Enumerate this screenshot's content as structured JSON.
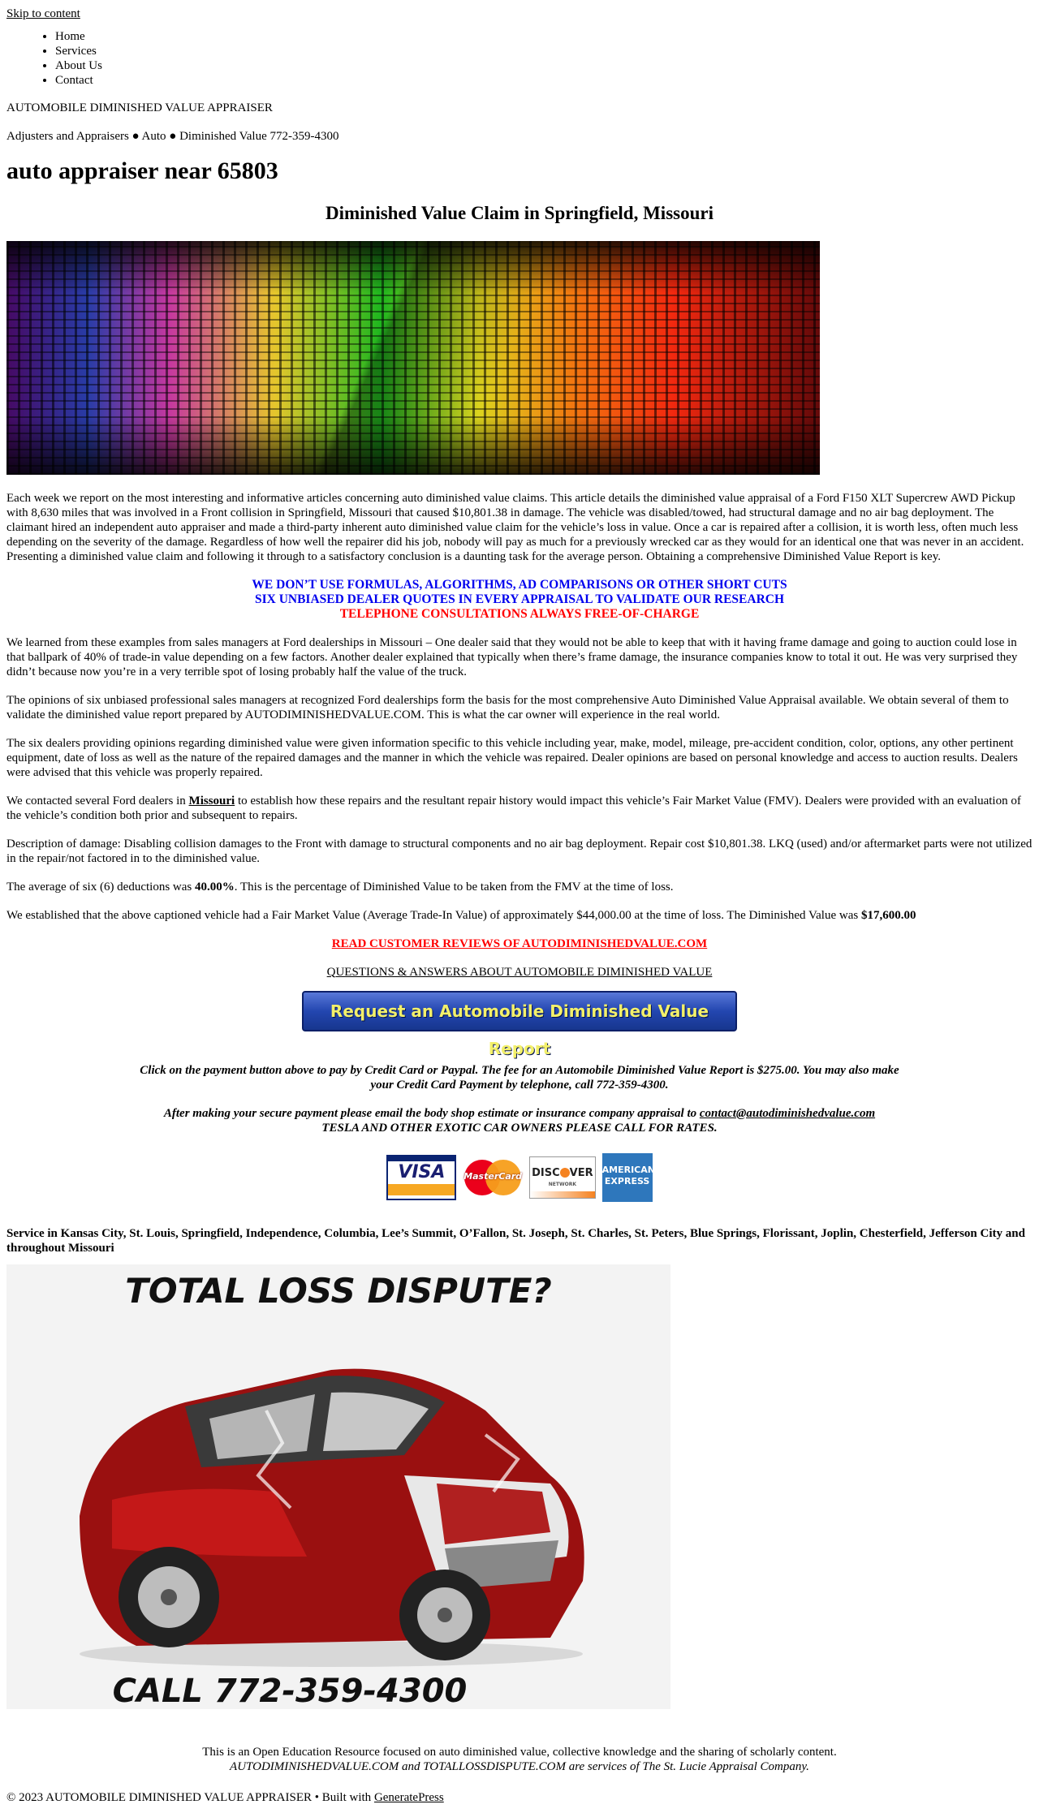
{
  "skip_link": "Skip to content",
  "nav": {
    "items": [
      "Home",
      "Services",
      "About Us",
      "Contact"
    ]
  },
  "site": {
    "title": "AUTOMOBILE DIMINISHED VALUE APPRAISER",
    "description": "Adjusters and Appraisers ● Auto ● Diminished Value 772-359-4300"
  },
  "page": {
    "title": "auto appraiser near 65803",
    "subtitle": "Diminished Value Claim in Springfield, Missouri"
  },
  "article": {
    "intro": "Each week we report on the most interesting and informative articles concerning auto diminished value claims. This article details the diminished value appraisal of a Ford F150 XLT Supercrew AWD Pickup with 8,630 miles that was involved in a Front collision in Springfield, Missouri that caused $10,801.38 in damage. The vehicle was disabled/towed, had structural damage and no air bag deployment. The claimant hired an independent auto appraiser and made a third-party inherent auto diminished value claim for the vehicle’s loss in value. Once a car is repaired after a collision, it is worth less, often much less depending on the severity of the damage. Regardless of how well the repairer did his job, nobody will pay as much for a previously wrecked car as they would for an identical one that was never in an accident. Presenting a diminished value claim and following it through to a satisfactory conclusion is a daunting task for the average person. Obtaining a comprehensive Diminished Value Report is key.",
    "callout_1": "WE DON’T USE FORMULAS, ALGORITHMS, AD COMPARISONS OR OTHER SHORT CUTS",
    "callout_2": "SIX UNBIASED DEALER QUOTES IN EVERY APPRAISAL TO VALIDATE OUR RESEARCH",
    "callout_3": "TELEPHONE CONSULTATIONS ALWAYS FREE-OF-CHARGE",
    "p1": "We learned from these examples from sales managers at Ford dealerships in Missouri – One dealer said that they would not be able to keep that with it having frame damage and going to auction could lose in that ballpark of 40% of trade-in value depending on a few factors. Another dealer explained that typically when there’s frame damage, the insurance companies know to total it out. He was very surprised they didn’t because now you’re in a very terrible spot of losing probably half the value of the truck.",
    "p2": "The opinions of six unbiased professional sales managers at recognized Ford dealerships form the basis for the most comprehensive Auto Diminished Value Appraisal available. We obtain several of them to validate the diminished value report prepared by AUTODIMINISHEDVALUE.COM. This is what the car owner will experience in the real world.",
    "p3": "The six dealers providing opinions regarding diminished value were given information specific to this vehicle including year, make, model, mileage, pre-accident condition, color, options, any other pertinent equipment, date of loss as well as the nature of the repaired damages and the manner in which the vehicle was repaired. Dealer opinions are based on personal knowledge and access to auction results. Dealers were advised that this vehicle was properly repaired.",
    "p4_before": "We contacted several Ford dealers in ",
    "p4_link": "Missouri",
    "p4_after": " to establish how these repairs and the resultant repair history would impact this vehicle’s Fair Market Value (FMV). Dealers were provided with an evaluation of the vehicle’s condition both prior and subsequent to repairs.",
    "p5": "Description of damage: Disabling collision damages to the Front with damage to structural components and no air bag deployment. Repair cost $10,801.38. LKQ (used) and/or aftermarket parts were not utilized in the repair/not factored in to the diminished value.",
    "p6_before": "The average of six (6) deductions was ",
    "p6_value": "40.00%",
    "p6_after": ". This is the percentage of Diminished Value to be taken from the FMV at the time of loss.",
    "p7_before": "We established that the above captioned vehicle had a Fair Market Value (Average Trade-In Value) of approximately $44,000.00 at the time of loss. The Diminished Value was ",
    "p7_value": "$17,600.00"
  },
  "links": {
    "reviews": "READ CUSTOMER REVIEWS OF AUTODIMINISHEDVALUE.COM",
    "qa": "QUESTIONS & ANSWERS ABOUT AUTOMOBILE DIMINISHED VALUE"
  },
  "payment": {
    "button_label": "Request an Automobile Diminished Value Report",
    "note_1": "Click on the payment button above to pay by Credit Card or Paypal. The fee for an Automobile Diminished Value Report is $275.00. You may also make your Credit Card Payment by telephone, call 772-359-4300.",
    "note_2_before": "After making your secure payment please email the body shop estimate or insurance company appraisal to ",
    "note_2_email": "contact@autodiminishedvalue.com",
    "note_2_line2": "TESLA AND OTHER EXOTIC CAR OWNERS PLEASE CALL FOR RATES.",
    "cards": {
      "visa": "VISA",
      "mastercard": "MasterCard",
      "discover_a": "DISC",
      "discover_b": "VER",
      "discover_network": "NETWORK",
      "amex_1": "AMERICAN",
      "amex_2": "EXPRESS"
    }
  },
  "service_area": "Service in Kansas City, St. Louis, Springfield, Independence, Columbia, Lee’s Summit, O’Fallon, St. Joseph, St. Charles, St. Peters, Blue Springs, Florissant, Joplin, Chesterfield, Jefferson City and throughout Missouri",
  "total_loss_image": {
    "headline": "TOTAL LOSS DISPUTE?",
    "call": "CALL 772-359-4300"
  },
  "footer": {
    "line_1": "This is an Open Education Resource focused on auto diminished value, collective knowledge and the sharing of scholarly content.",
    "line_2": "AUTODIMINISHEDVALUE.COM and TOTALLOSSDISPUTE.COM are services of The St. Lucie Appraisal Company.",
    "copyright": "© 2023 AUTOMOBILE DIMINISHED VALUE APPRAISER • Built with ",
    "builder_link": "GeneratePress"
  }
}
